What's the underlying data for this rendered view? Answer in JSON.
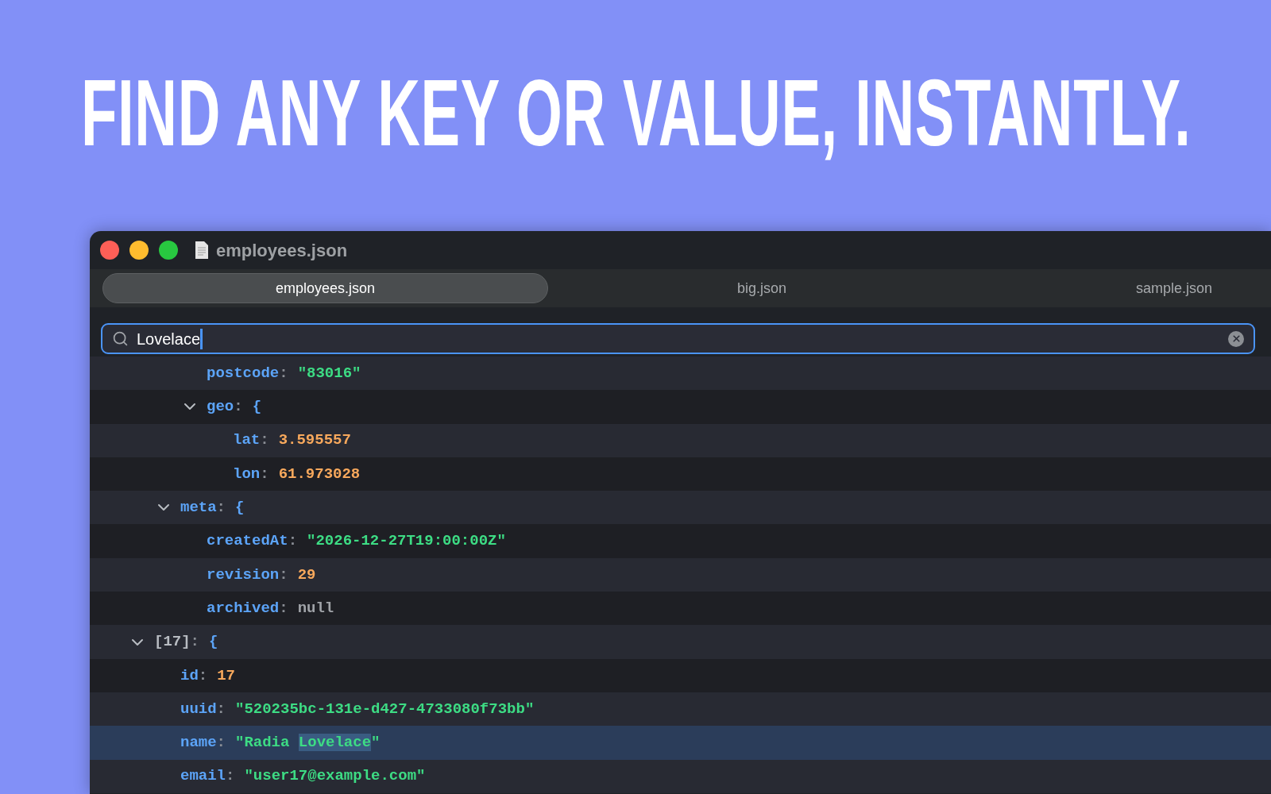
{
  "headline": "FIND ANY KEY OR VALUE, INSTANTLY.",
  "window": {
    "title": "employees.json"
  },
  "tabs": [
    {
      "label": "employees.json",
      "selected": true
    },
    {
      "label": "big.json",
      "selected": false
    },
    {
      "label": "sample.json",
      "selected": false
    }
  ],
  "search": {
    "value": "Lovelace"
  },
  "key_separator": ":",
  "tree": [
    {
      "children": [
        {
          "children": [
            {
              "key": "postcode",
              "value": "\"83016\"",
              "kind": "string",
              "selected": false
            },
            {
              "key": "geo",
              "value": "{",
              "kind": "object",
              "expanded": true,
              "selected": false,
              "children": [
                {
                  "key": "lat",
                  "value": "3.595557",
                  "kind": "number",
                  "selected": false
                },
                {
                  "key": "lon",
                  "value": "61.973028",
                  "kind": "number",
                  "selected": false
                }
              ]
            }
          ]
        },
        {
          "key": "meta",
          "value": "{",
          "kind": "object",
          "expanded": true,
          "selected": false,
          "children": [
            {
              "key": "createdAt",
              "value": "\"2026-12-27T19:00:00Z\"",
              "kind": "string",
              "selected": false
            },
            {
              "key": "revision",
              "value": "29",
              "kind": "number",
              "selected": false
            },
            {
              "key": "archived",
              "value": "null",
              "kind": "null",
              "selected": false
            }
          ]
        }
      ]
    },
    {
      "index": "[17]",
      "value": "{",
      "kind": "object",
      "expanded": true,
      "selected": false,
      "children": [
        {
          "key": "id",
          "value": "17",
          "kind": "number",
          "selected": false
        },
        {
          "key": "uuid",
          "value": "\"520235bc-131e-d427-4733080f73bb\"",
          "kind": "string",
          "selected": false
        },
        {
          "key": "name",
          "kind": "string",
          "selected": true,
          "value_parts": [
            {
              "text": "\"Radia ",
              "match": false
            },
            {
              "text": "Lovelace",
              "match": true
            },
            {
              "text": "\"",
              "match": false
            }
          ]
        },
        {
          "key": "email",
          "value": "\"user17@example.com\"",
          "kind": "string",
          "selected": false
        }
      ]
    }
  ]
}
